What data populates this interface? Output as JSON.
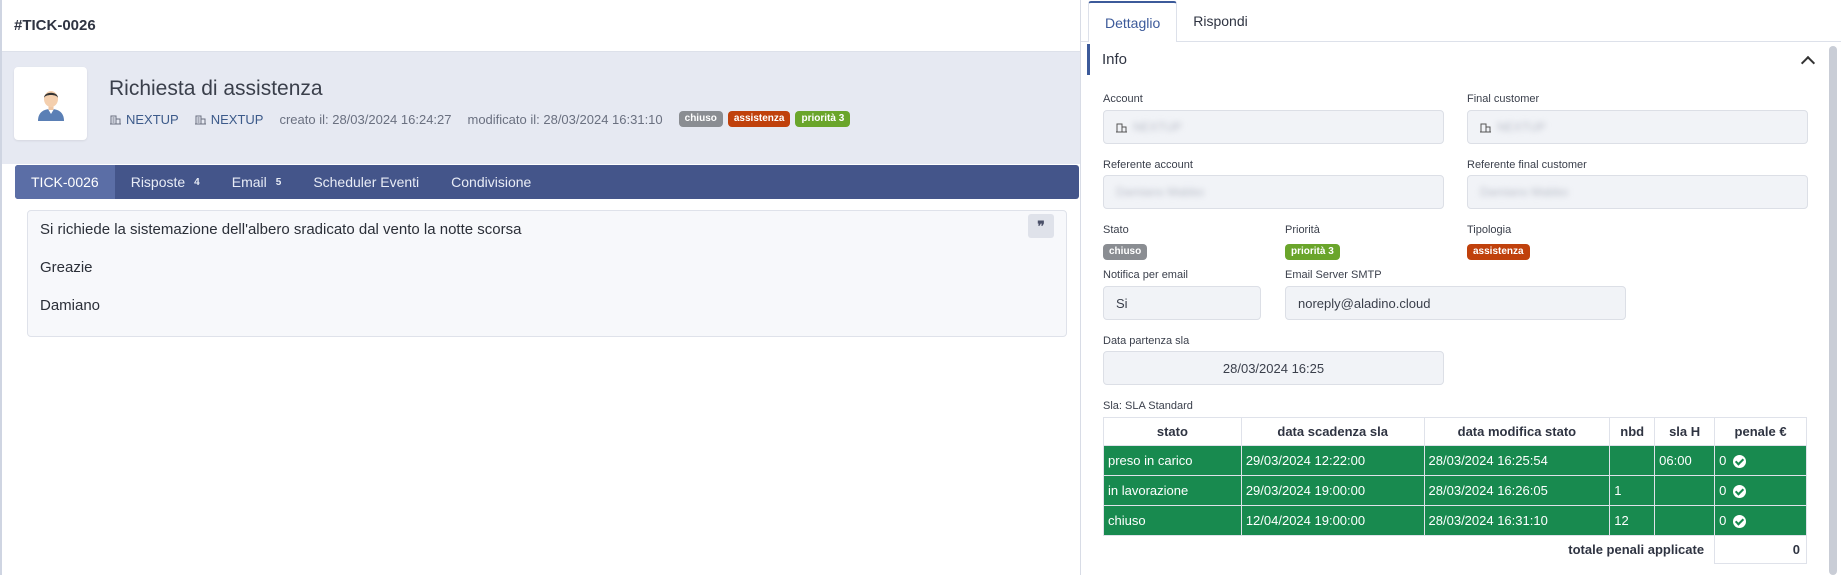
{
  "ticket": {
    "id": "#TICK-0026",
    "title": "Richiesta di assistenza",
    "account1": "NEXTUP",
    "account2": "NEXTUP",
    "created": "creato il: 28/03/2024 16:24:27",
    "modified": "modificato il: 28/03/2024 16:31:10",
    "badges": {
      "stato": "chiuso",
      "tipologia": "assistenza",
      "priorita": "priorità 3"
    }
  },
  "tabs": {
    "main": "TICK-0026",
    "risposte": "Risposte",
    "risposte_count": "4",
    "email": "Email",
    "email_count": "5",
    "scheduler": "Scheduler Eventi",
    "condivisione": "Condivisione"
  },
  "message": {
    "line1": "Si richiede la sistemazione dell'albero sradicato dal vento la notte scorsa",
    "line2": "Greazie",
    "line3": "Damiano",
    "quote_icon": "❞"
  },
  "right": {
    "tab_dettaglio": "Dettaglio",
    "tab_rispondi": "Rispondi",
    "section": "Info",
    "labels": {
      "account": "Account",
      "final_customer": "Final customer",
      "referente_account": "Referente account",
      "referente_final": "Referente final customer",
      "stato": "Stato",
      "priorita": "Priorità",
      "tipologia": "Tipologia",
      "notifica": "Notifica per email",
      "smtp": "Email Server SMTP",
      "data_partenza": "Data partenza sla",
      "sla": "Sla: SLA Standard"
    },
    "values": {
      "account": "NEXTUP",
      "final_customer": "NEXTUP",
      "referente_account": "Damiano Mabbo",
      "referente_final": "Damiano Mabbo",
      "stato": "chiuso",
      "priorita": "priorità 3",
      "tipologia": "assistenza",
      "notifica": "Si",
      "smtp": "noreply@aladino.cloud",
      "data_partenza": "28/03/2024 16:25"
    }
  },
  "sla_table": {
    "headers": [
      "stato",
      "data scadenza sla",
      "data modifica stato",
      "nbd",
      "sla H",
      "penale €"
    ],
    "rows": [
      [
        "preso in carico",
        "29/03/2024 12:22:00",
        "28/03/2024 16:25:54",
        "",
        "06:00",
        "0"
      ],
      [
        "in lavorazione",
        "29/03/2024 19:00:00",
        "28/03/2024 16:26:05",
        "1",
        "",
        "0"
      ],
      [
        "chiuso",
        "12/04/2024 19:00:00",
        "28/03/2024 16:31:10",
        "12",
        "",
        "0"
      ]
    ],
    "total_label": "totale penali applicate",
    "total_value": "0"
  },
  "colors": {
    "nav": "#44558a",
    "accent": "#3c5a9a",
    "sla_green": "#188a4f"
  },
  "icons": [
    "building-icon",
    "avatar-icon",
    "quote-icon",
    "chevron-up-icon",
    "check-circle-icon"
  ]
}
